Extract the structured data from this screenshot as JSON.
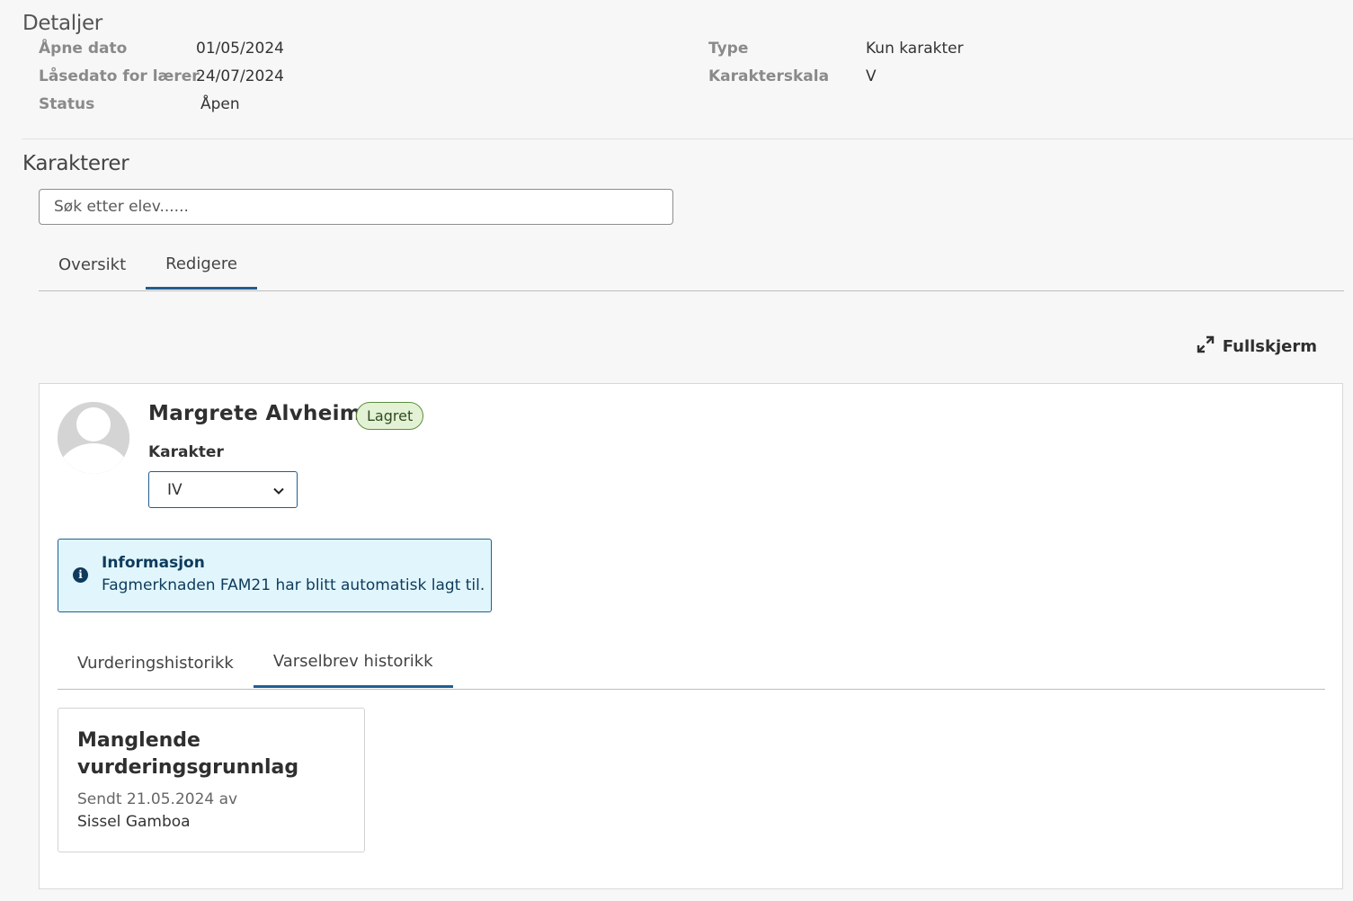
{
  "details": {
    "title": "Detaljer",
    "left": [
      {
        "label": "Åpne dato",
        "value": "01/05/2024"
      },
      {
        "label": "Låsedato for lærer",
        "value": "24/07/2024"
      },
      {
        "label": "Status",
        "value": "Åpen"
      }
    ],
    "right": [
      {
        "label": "Type",
        "value": "Kun karakter"
      },
      {
        "label": "Karakterskala",
        "value": "V"
      }
    ]
  },
  "grades": {
    "title": "Karakterer",
    "search": {
      "placeholder": "Søk etter elev......"
    },
    "tabs": [
      {
        "label": "Oversikt",
        "active": false
      },
      {
        "label": "Redigere",
        "active": true
      }
    ],
    "fullscreen_label": "Fullskjerm"
  },
  "student": {
    "name": "Margrete Alvheim",
    "badge": "Lagret",
    "grade_label": "Karakter",
    "grade_value": "IV",
    "info": {
      "title": "Informasjon",
      "text": "Fagmerknaden FAM21 har blitt automatisk lagt til."
    },
    "history_tabs": [
      {
        "label": "Vurderingshistorikk",
        "active": false
      },
      {
        "label": "Varselbrev historikk",
        "active": true
      }
    ],
    "letter": {
      "title": "Manglende vurderingsgrunnlag",
      "meta": "Sendt 21.05.2024 av",
      "author": "Sissel Gamboa"
    }
  },
  "colors": {
    "accent": "#1f5e91",
    "badge_bg": "#e3f2d5",
    "info_bg": "#e0f6fc"
  }
}
